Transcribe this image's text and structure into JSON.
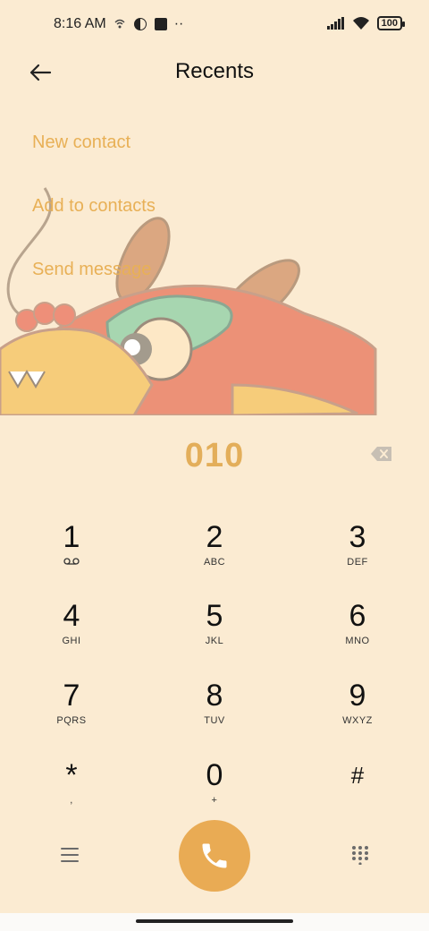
{
  "status": {
    "time": "8:16 AM",
    "battery": "100"
  },
  "header": {
    "title": "Recents"
  },
  "actions": {
    "new_contact": "New contact",
    "add_to_contacts": "Add to contacts",
    "send_message": "Send message"
  },
  "dialer": {
    "number": "010",
    "keys": [
      {
        "digit": "1",
        "letters": ""
      },
      {
        "digit": "2",
        "letters": "ABC"
      },
      {
        "digit": "3",
        "letters": "DEF"
      },
      {
        "digit": "4",
        "letters": "GHI"
      },
      {
        "digit": "5",
        "letters": "JKL"
      },
      {
        "digit": "6",
        "letters": "MNO"
      },
      {
        "digit": "7",
        "letters": "PQRS"
      },
      {
        "digit": "8",
        "letters": "TUV"
      },
      {
        "digit": "9",
        "letters": "WXYZ"
      },
      {
        "digit": "*",
        "letters": ","
      },
      {
        "digit": "0",
        "letters": "+"
      },
      {
        "digit": "#",
        "letters": ""
      }
    ]
  },
  "icons": {
    "voicemail": "voicemail-icon",
    "menu": "menu-icon",
    "call": "phone-icon",
    "keypad": "dialpad-icon",
    "back": "back-arrow-icon",
    "backspace": "backspace-icon"
  },
  "colors": {
    "background": "#fbebd2",
    "accent": "#e9ab54",
    "action_text": "#e8b056"
  }
}
